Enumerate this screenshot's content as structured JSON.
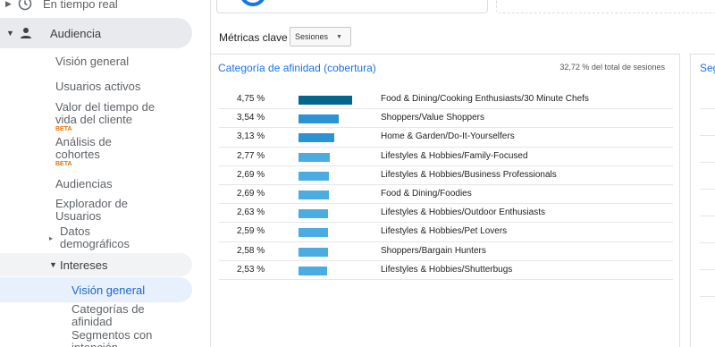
{
  "sidebar": {
    "realtime_label": "En tiempo real",
    "audience_label": "Audiencia",
    "items": [
      {
        "label": "Visión general"
      },
      {
        "label": "Usuarios activos"
      },
      {
        "label": "Valor del tiempo de vida del cliente",
        "badge": "BETA"
      },
      {
        "label": "Análisis de cohortes",
        "badge": "BETA"
      },
      {
        "label": "Audiencias"
      },
      {
        "label": "Explorador de Usuarios"
      },
      {
        "label": "Datos demográficos"
      }
    ],
    "interests_label": "Intereses",
    "interests_items": [
      {
        "label": "Visión general"
      },
      {
        "label": "Categorías de afinidad"
      },
      {
        "label": "Segmentos con intención..."
      }
    ]
  },
  "metrics": {
    "label": "Métricas clave",
    "select_value": "Sesiones"
  },
  "panel": {
    "title": "Categoría de afinidad (cobertura)",
    "total_text": "32,72 % del total de sesiones"
  },
  "right_panel": {
    "title": "Seg"
  },
  "colors": {
    "accent": "#1a73e8",
    "bar_top": "#05668d",
    "bar_mid": "#2a93d5",
    "bar_light": "#4aace0",
    "selected_bg": "#e8f0fe",
    "beta": "#e8710a"
  },
  "chart_data": {
    "type": "bar",
    "title": "Categoría de afinidad (cobertura)",
    "categories": [
      "Food & Dining/Cooking Enthusiasts/30 Minute Chefs",
      "Shoppers/Value Shoppers",
      "Home & Garden/Do-It-Yourselfers",
      "Lifestyles & Hobbies/Family-Focused",
      "Lifestyles & Hobbies/Business Professionals",
      "Food & Dining/Foodies",
      "Lifestyles & Hobbies/Outdoor Enthusiasts",
      "Lifestyles & Hobbies/Pet Lovers",
      "Shoppers/Bargain Hunters",
      "Lifestyles & Hobbies/Shutterbugs"
    ],
    "values": [
      4.75,
      3.54,
      3.13,
      2.77,
      2.69,
      2.69,
      2.63,
      2.59,
      2.58,
      2.53
    ],
    "value_labels": [
      "4,75 %",
      "3,54 %",
      "3,13 %",
      "2,77 %",
      "2,69 %",
      "2,69 %",
      "2,63 %",
      "2,59 %",
      "2,58 %",
      "2,53 %"
    ],
    "bar_colors": [
      "#05668d",
      "#2a93d5",
      "#2a93d5",
      "#4aace0",
      "#4aace0",
      "#4aace0",
      "#4aace0",
      "#4aace0",
      "#4aace0",
      "#4aace0"
    ]
  }
}
